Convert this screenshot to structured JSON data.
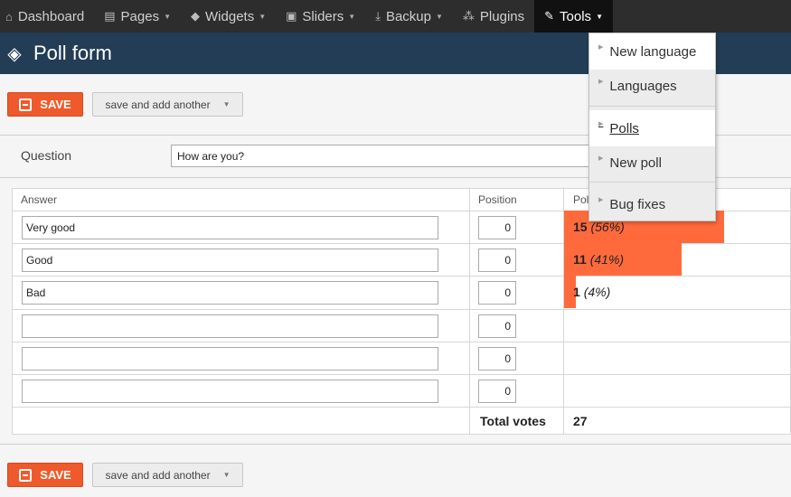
{
  "nav": {
    "items": [
      {
        "label": "Dashboard",
        "icon": "home-icon",
        "glyph": "⌂",
        "caret": ""
      },
      {
        "label": "Pages",
        "icon": "page-icon",
        "glyph": "▤",
        "caret": "▼"
      },
      {
        "label": "Widgets",
        "icon": "cube-icon",
        "glyph": "◆",
        "caret": "▼"
      },
      {
        "label": "Sliders",
        "icon": "slider-icon",
        "glyph": "▣",
        "caret": "▼"
      },
      {
        "label": "Backup",
        "icon": "download-icon",
        "glyph": "⤓",
        "caret": "▼"
      },
      {
        "label": "Plugins",
        "icon": "plugin-icon",
        "glyph": "⁂",
        "caret": ""
      },
      {
        "label": "Tools",
        "icon": "wrench-icon",
        "glyph": "✎",
        "caret": "▼"
      }
    ]
  },
  "page": {
    "title": "Poll form",
    "icon_glyph": "◈"
  },
  "buttons": {
    "save": "SAVE",
    "save_another": "save and add another",
    "caret": "▼"
  },
  "question": {
    "label": "Question",
    "value": "How are you?"
  },
  "table": {
    "headers": {
      "answer": "Answer",
      "position": "Position",
      "poll": "Pol"
    },
    "rows": [
      {
        "answer": "Very good",
        "position": "0",
        "votes": "15",
        "percent": "(56%)",
        "fraction": 0.56
      },
      {
        "answer": "Good",
        "position": "0",
        "votes": "11",
        "percent": "(41%)",
        "fraction": 0.41
      },
      {
        "answer": "Bad",
        "position": "0",
        "votes": "1",
        "percent": "(4%)",
        "fraction": 0.04
      },
      {
        "answer": "",
        "position": "0"
      },
      {
        "answer": "",
        "position": "0"
      },
      {
        "answer": "",
        "position": "0"
      }
    ],
    "total_label": "Total votes",
    "total_value": "27"
  },
  "tools_menu": {
    "items": [
      "New language",
      "Languages",
      "Polls",
      "New poll",
      "Bug fixes"
    ]
  },
  "colors": {
    "accent": "#ee5a2b",
    "bar": "#ff6a3d",
    "titlebar": "#233d56",
    "nav": "#2d2d2d"
  }
}
